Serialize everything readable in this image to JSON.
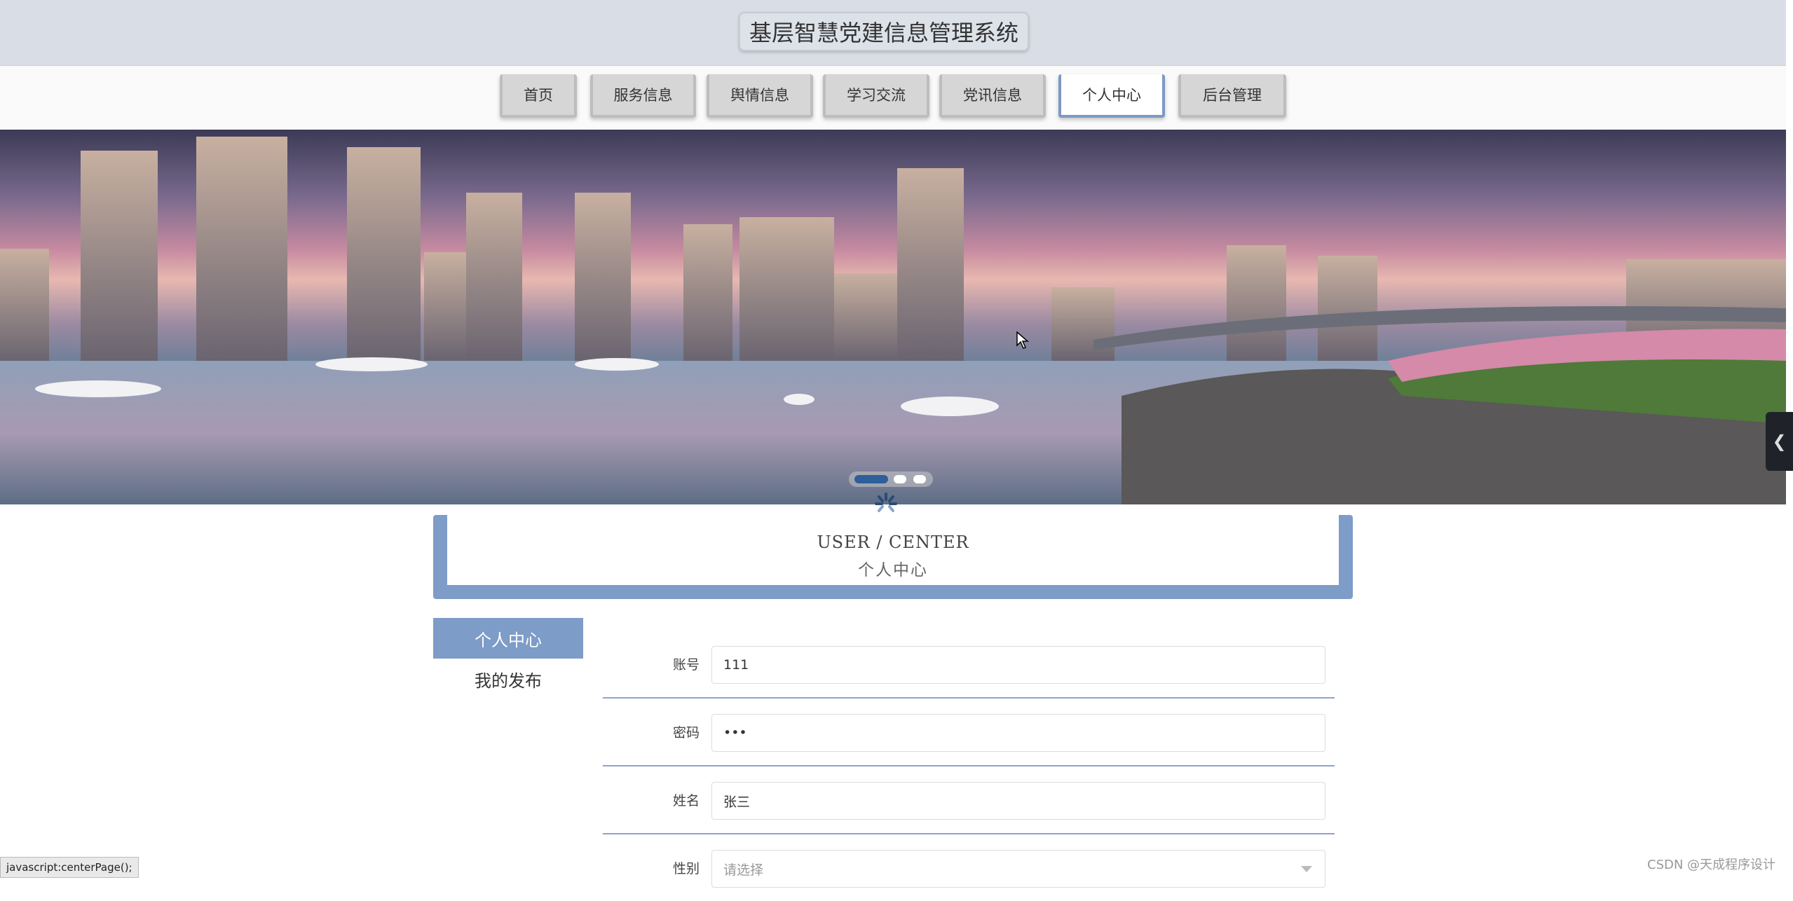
{
  "site_title": "基层智慧党建信息管理系统",
  "nav": [
    "首页",
    "服务信息",
    "舆情信息",
    "学习交流",
    "党讯信息",
    "个人中心",
    "后台管理"
  ],
  "active_nav": "个人中心",
  "carousel": {
    "slides": 3,
    "active_index": 0
  },
  "section": {
    "en": "USER / CENTER",
    "cn": "个人中心"
  },
  "sidebar": [
    "个人中心",
    "我的发布"
  ],
  "form": [
    {
      "label": "账号",
      "value": "111"
    },
    {
      "label": "密码",
      "value": "•••"
    },
    {
      "label": "姓名",
      "value": "张三"
    },
    {
      "label": "性别",
      "placeholder": "请选择"
    }
  ],
  "status_bar": "javascript:centerPage();",
  "watermark": "CSDN @天成程序设计",
  "colors": {
    "accent": "#7d9cc7",
    "header_bg": "#d9dee6"
  },
  "icons": {
    "side_handle": "chevron-left-icon",
    "loading": "spinner-icon"
  }
}
